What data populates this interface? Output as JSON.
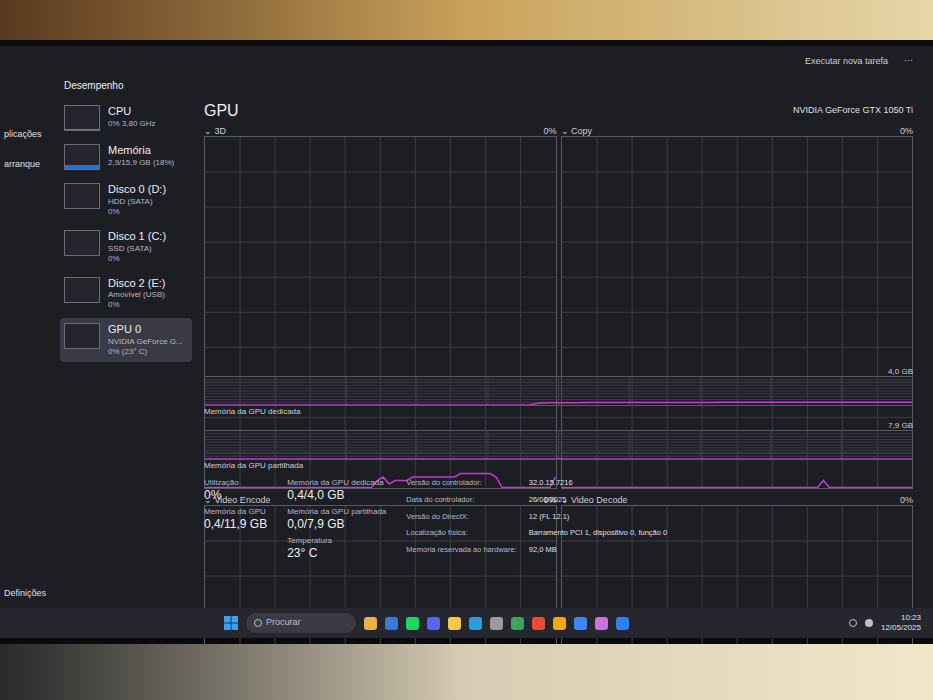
{
  "window": {
    "title": "Desempenho",
    "actions": [
      "Executar nova tarefa",
      "⋯"
    ]
  },
  "nav": {
    "items": [
      "plicações",
      "arranque"
    ],
    "footer": "Definições"
  },
  "sidebar": {
    "items": [
      {
        "name": "CPU",
        "detail": "0% 3,80 GHz",
        "sub": "",
        "selected": false,
        "level": 0.05,
        "color": "#2a8fd8"
      },
      {
        "name": "Memória",
        "detail": "2,9/15,9 GB (18%)",
        "sub": "",
        "selected": false,
        "level": 0.18,
        "color": "#2a6fd8"
      },
      {
        "name": "Disco 0 (D:)",
        "detail": "HDD (SATA)",
        "sub": "0%",
        "selected": false,
        "level": 0,
        "color": "#4caf50"
      },
      {
        "name": "Disco 1 (C:)",
        "detail": "SSD (SATA)",
        "sub": "0%",
        "selected": false,
        "level": 0,
        "color": "#4caf50"
      },
      {
        "name": "Disco 2 (E:)",
        "detail": "Amovível (USB)",
        "sub": "0%",
        "selected": false,
        "level": 0,
        "color": "#4caf50"
      },
      {
        "name": "GPU 0",
        "detail": "NVIDIA GeForce G...",
        "sub": "0% (23° C)",
        "selected": true,
        "level": 0,
        "color": "#8a7ad8"
      }
    ]
  },
  "header": {
    "title": "GPU",
    "device": "NVIDIA GeForce GTX 1050 Ti"
  },
  "engine_charts": [
    {
      "label": "3D",
      "reading": "0%",
      "axis_max": 100,
      "values": [
        0,
        0,
        0,
        0,
        0,
        0,
        0,
        0,
        0,
        0,
        0,
        0,
        0,
        0,
        0,
        0,
        0,
        0,
        0,
        0,
        0,
        0,
        0,
        0,
        0,
        0,
        0,
        0,
        0,
        2,
        3,
        1,
        2,
        2,
        2,
        3,
        3,
        3,
        3,
        3,
        3,
        3,
        3,
        4,
        4,
        4,
        4,
        4,
        4,
        3,
        0,
        0,
        0,
        0,
        0,
        0,
        0,
        0,
        0,
        3
      ]
    },
    {
      "label": "Copy",
      "reading": "0%",
      "axis_max": 100,
      "values": [
        0,
        0,
        0,
        0,
        0,
        0,
        0,
        0,
        0,
        0,
        0,
        0,
        0,
        0,
        0,
        0,
        0,
        0,
        0,
        0,
        0,
        0,
        0,
        0,
        0,
        0,
        0,
        0,
        0,
        0,
        0,
        0,
        0,
        0,
        0,
        0,
        0,
        0,
        0,
        0,
        0,
        0,
        0,
        0,
        2,
        0,
        0,
        0,
        0,
        0,
        0,
        0,
        0,
        0,
        0,
        0,
        0,
        0,
        0,
        0
      ]
    },
    {
      "label": "Video Encode",
      "reading": "0%",
      "axis_max": 100,
      "values": [
        0,
        0,
        0,
        0,
        0,
        0,
        0,
        0,
        0,
        0,
        0,
        0,
        0,
        0,
        0,
        0,
        0,
        0,
        0,
        0,
        0,
        0,
        0,
        0,
        0,
        0,
        0,
        0,
        0,
        0,
        0,
        0,
        0,
        0,
        0,
        0,
        0,
        0,
        0,
        0,
        0,
        0,
        0,
        0,
        0,
        0,
        0,
        0,
        0,
        0,
        0,
        0,
        0,
        0,
        0,
        0,
        0,
        0,
        0,
        0
      ]
    },
    {
      "label": "Video Decode",
      "reading": "0%",
      "axis_max": 100,
      "values": [
        0,
        0,
        0,
        0,
        0,
        0,
        0,
        0,
        0,
        0,
        0,
        0,
        0,
        0,
        0,
        0,
        0,
        0,
        0,
        0,
        0,
        0,
        0,
        0,
        0,
        0,
        0,
        0,
        0,
        0,
        0,
        0,
        0,
        0,
        0,
        0,
        0,
        0,
        0,
        0,
        0,
        0,
        0,
        0,
        0,
        0,
        0,
        0,
        0,
        0,
        0,
        0,
        0,
        0,
        0,
        0,
        0,
        0,
        0,
        0
      ]
    }
  ],
  "memory_charts": [
    {
      "label": "Memória da GPU dedicada",
      "reading": "4,0 GB",
      "axis_max": 4,
      "values": [
        0,
        0,
        0,
        0,
        0,
        0,
        0,
        0,
        0,
        0,
        0,
        0,
        0,
        0,
        0,
        0,
        0,
        0,
        0,
        0,
        0,
        0,
        0,
        0,
        0,
        0,
        0,
        0,
        0.3,
        0.32,
        0.33,
        0.33,
        0.34,
        0.34,
        0.35,
        0.35,
        0.35,
        0.36,
        0.36,
        0.36,
        0.37,
        0.37,
        0.37,
        0.38,
        0.38,
        0.38,
        0.38,
        0.39,
        0.39,
        0.39,
        0.39,
        0.4,
        0.4,
        0.4,
        0.4,
        0.4,
        0.4,
        0.4,
        0.4,
        0.4
      ]
    },
    {
      "label": "Memória da GPU partilhada",
      "reading": "7,9 GB",
      "axis_max": 7.9,
      "values": [
        0,
        0,
        0,
        0,
        0,
        0,
        0,
        0,
        0,
        0,
        0,
        0,
        0,
        0,
        0,
        0,
        0,
        0,
        0,
        0,
        0,
        0,
        0,
        0,
        0,
        0,
        0,
        0,
        0,
        0,
        0,
        0,
        0,
        0,
        0,
        0,
        0,
        0,
        0,
        0,
        0,
        0,
        0,
        0,
        0,
        0,
        0,
        0,
        0,
        0,
        0,
        0,
        0,
        0,
        0,
        0,
        0,
        0,
        0,
        0
      ]
    }
  ],
  "stats": [
    [
      {
        "label": "Utilização",
        "value": "0%"
      },
      {
        "label": "Memória da GPU",
        "value": "0,4/11,9 GB"
      }
    ],
    [
      {
        "label": "Memória da GPU dedicada",
        "value": "0,4/4,0 GB"
      },
      {
        "label": "Memória da GPU partilhada",
        "value": "0,0/7,9 GB"
      },
      {
        "label": "Temperatura",
        "value": "23° C"
      }
    ]
  ],
  "info": [
    {
      "key": "Versão do controlador:",
      "value": "32.0.15.7216"
    },
    {
      "key": "Data do controlador:",
      "value": "26/01/2025"
    },
    {
      "key": "Versão do DirectX:",
      "value": "12 (FL 12.1)"
    },
    {
      "key": "Localização física:",
      "value": "Barramento PCI 1, dispositivo 0, função 0"
    },
    {
      "key": "Memória reservada ao hardware:",
      "value": "92,0 MB"
    }
  ],
  "taskbar": {
    "search": "Procurar",
    "time": "10:23",
    "date": "12/05/2025"
  }
}
